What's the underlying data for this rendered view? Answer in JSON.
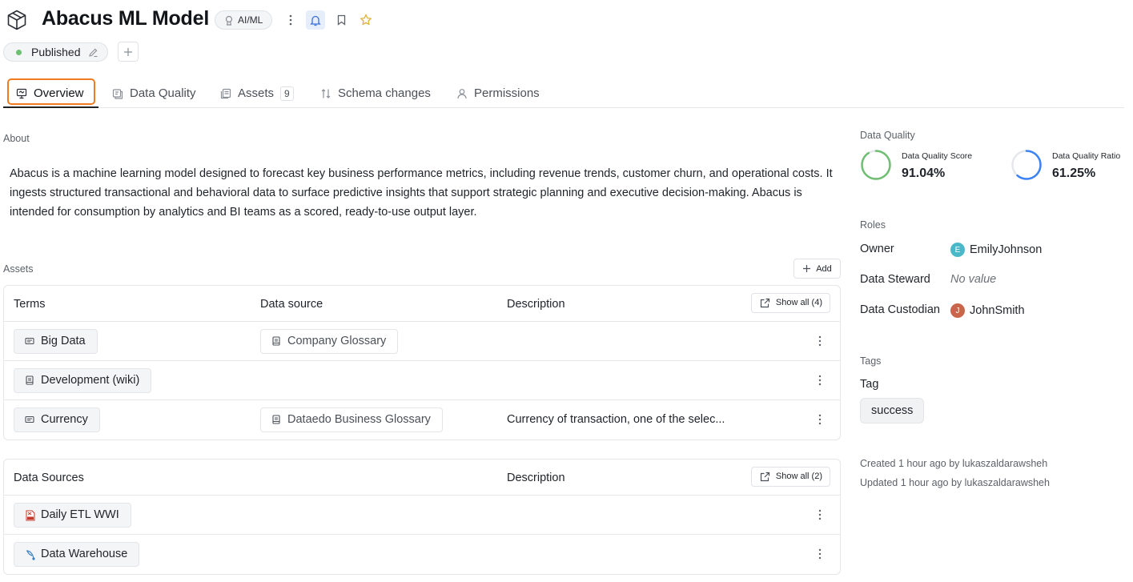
{
  "header": {
    "title": "Abacus ML Model",
    "type_badge": "AI/ML",
    "status": "Published"
  },
  "tabs": [
    {
      "label": "Overview",
      "icon": "overview-icon",
      "active": true
    },
    {
      "label": "Data Quality",
      "icon": "data-quality-icon"
    },
    {
      "label": "Assets",
      "icon": "assets-icon",
      "count": "9"
    },
    {
      "label": "Schema changes",
      "icon": "schema-changes-icon"
    },
    {
      "label": "Permissions",
      "icon": "permissions-icon"
    }
  ],
  "about": {
    "label": "About",
    "text": "Abacus is a machine learning model designed to forecast key business performance metrics, including revenue trends, customer churn, and operational costs. It ingests structured transactional and behavioral data to surface predictive insights that support strategic planning and executive decision-making. Abacus is intended for consumption by analytics and BI teams as a scored, ready-to-use output layer."
  },
  "assets": {
    "label": "Assets",
    "add_label": "Add",
    "terms_table": {
      "columns": [
        "Terms",
        "Data source",
        "Description"
      ],
      "show_all": "Show all (4)",
      "rows": [
        {
          "term": "Big Data",
          "term_icon": "term-icon",
          "source": "Company Glossary",
          "description": ""
        },
        {
          "term": "Development (wiki)",
          "term_icon": "wiki-icon",
          "source": "",
          "description": ""
        },
        {
          "term": "Currency",
          "term_icon": "term-icon",
          "source": "Dataedo Business Glossary",
          "description": "Currency of transaction, one of the selec..."
        }
      ]
    },
    "sources_table": {
      "columns": [
        "Data Sources",
        "Description"
      ],
      "show_all": "Show all (2)",
      "rows": [
        {
          "name": "Daily ETL WWI",
          "icon": "ssis-icon",
          "description": ""
        },
        {
          "name": "Data Warehouse",
          "icon": "database-icon",
          "description": ""
        }
      ]
    }
  },
  "data_quality": {
    "label": "Data Quality",
    "score_label": "Data Quality Score",
    "score_value": "91.04%",
    "score_fraction": 0.9104,
    "ratio_label": "Data Quality Ratio",
    "ratio_value": "61.25%",
    "ratio_fraction": 0.6125,
    "colors": {
      "score": "#6fbf73",
      "ratio": "#3b82f6",
      "track": "#e5e7eb"
    }
  },
  "roles": {
    "label": "Roles",
    "items": [
      {
        "role": "Owner",
        "value": "EmilyJohnson",
        "initial": "E",
        "color": "#4bb8c9"
      },
      {
        "role": "Data Steward",
        "value": "No value",
        "initial": "",
        "color": ""
      },
      {
        "role": "Data Custodian",
        "value": "JohnSmith",
        "initial": "J",
        "color": "#c8654a"
      }
    ]
  },
  "tags": {
    "label": "Tags",
    "group": "Tag",
    "values": [
      "success"
    ]
  },
  "meta": {
    "created": "Created 1 hour ago by lukaszaldarawsheh",
    "updated": "Updated 1 hour ago by lukaszaldarawsheh"
  }
}
